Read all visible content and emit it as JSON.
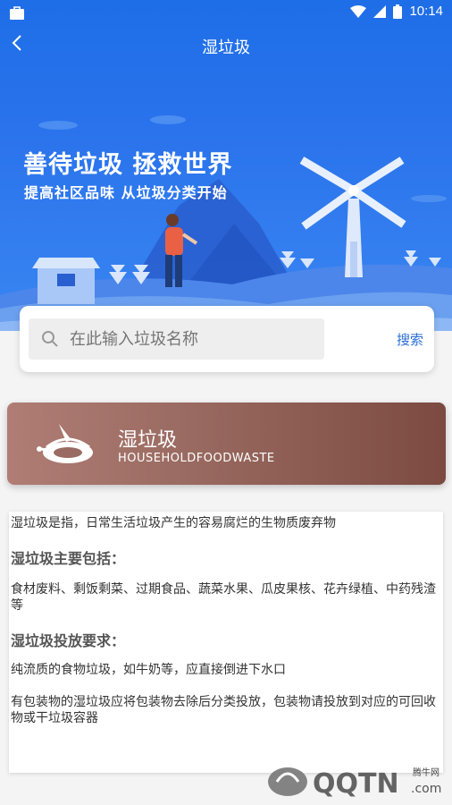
{
  "status_bar": {
    "time": "10:14"
  },
  "header": {
    "title": "湿垃圾"
  },
  "banner": {
    "slogan_main": "善待垃圾 拯救世界",
    "slogan_sub": "提高社区品味 从垃圾分类开始"
  },
  "search": {
    "placeholder": "在此输入垃圾名称",
    "button_label": "搜索"
  },
  "category": {
    "name": "湿垃圾",
    "english": "HOUSEHOLDFOODWASTE"
  },
  "content": {
    "definition": "湿垃圾是指，日常生活垃圾产生的容易腐烂的生物质废弃物",
    "includes_heading": "湿垃圾主要包括：",
    "includes_text": "食材废料、剩饭剩菜、过期食品、蔬菜水果、瓜皮果核、花卉绿植、中药残渣等",
    "requirements_heading": "湿垃圾投放要求：",
    "requirement_1": "纯流质的食物垃圾，如牛奶等，应直接倒进下水口",
    "requirement_2": "有包装物的湿垃圾应将包装物去除后分类投放，包装物请投放到对应的可回收物或干垃圾容器"
  },
  "watermark": {
    "text": "腾牛网"
  }
}
